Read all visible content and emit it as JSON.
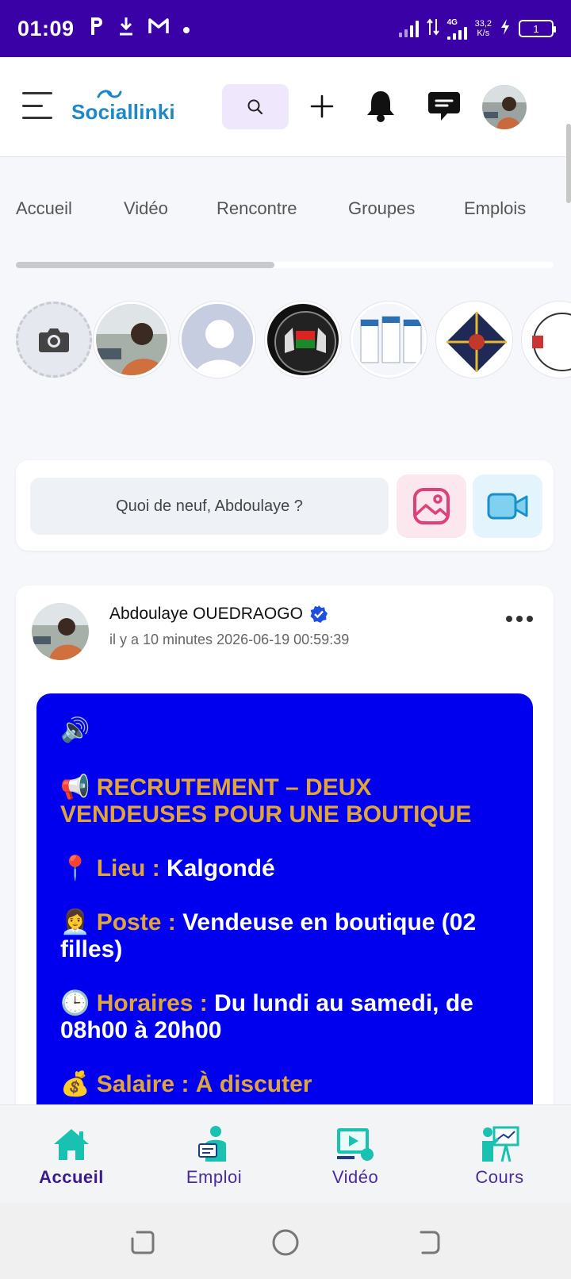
{
  "status_bar": {
    "time": "01:09",
    "net_type": "4G",
    "speed_value": "33,2",
    "speed_unit": "K/s",
    "battery_level": "1",
    "app_icons": [
      "parking-icon",
      "download-icon",
      "gmail-icon",
      "dot-icon"
    ]
  },
  "header": {
    "logo_text": "Sociallinki",
    "brand_color": "#1c88c7"
  },
  "nav_tabs": [
    "Accueil",
    "Vidéo",
    "Rencontre",
    "Groupes",
    "Emplois"
  ],
  "stories": [
    "camera",
    "user-1",
    "placeholder",
    "emblem",
    "app-screens",
    "infographic",
    "more"
  ],
  "composer": {
    "placeholder": "Quoi de neuf, Abdoulaye ?"
  },
  "post": {
    "author": "Abdoulaye OUEDRAOGO",
    "verified": true,
    "time_relative": "il y a 10 minutes",
    "timestamp": "2026-06-19 00:59:39",
    "body": {
      "speaker": "🔊",
      "headline_emoji": "📢",
      "headline": "RECRUTEMENT – DEUX VENDEUSES POUR UNE BOUTIQUE",
      "items": [
        {
          "emoji": "📍",
          "label": "Lieu :",
          "value": "Kalgondé"
        },
        {
          "emoji": "👩‍💼",
          "label": "Poste :",
          "value": "Vendeuse en boutique (02 filles)"
        },
        {
          "emoji": "🕒",
          "label": "Horaires :",
          "value": "Du lundi au samedi, de 08h00 à 20h00"
        },
        {
          "emoji": "💰",
          "label": "Salaire : À discuter",
          "value": ""
        }
      ]
    }
  },
  "bottom_nav": [
    {
      "label": "Accueil",
      "icon": "home-icon",
      "active": true
    },
    {
      "label": "Emploi",
      "icon": "job-icon",
      "active": false
    },
    {
      "label": "Vidéo",
      "icon": "video-icon",
      "active": false
    },
    {
      "label": "Cours",
      "icon": "course-icon",
      "active": false
    }
  ],
  "colors": {
    "status_bar": "#3a02a6",
    "post_background": "#0000ee",
    "gold_text": "#e0a53a",
    "nav_icon": "#19c2b0"
  }
}
